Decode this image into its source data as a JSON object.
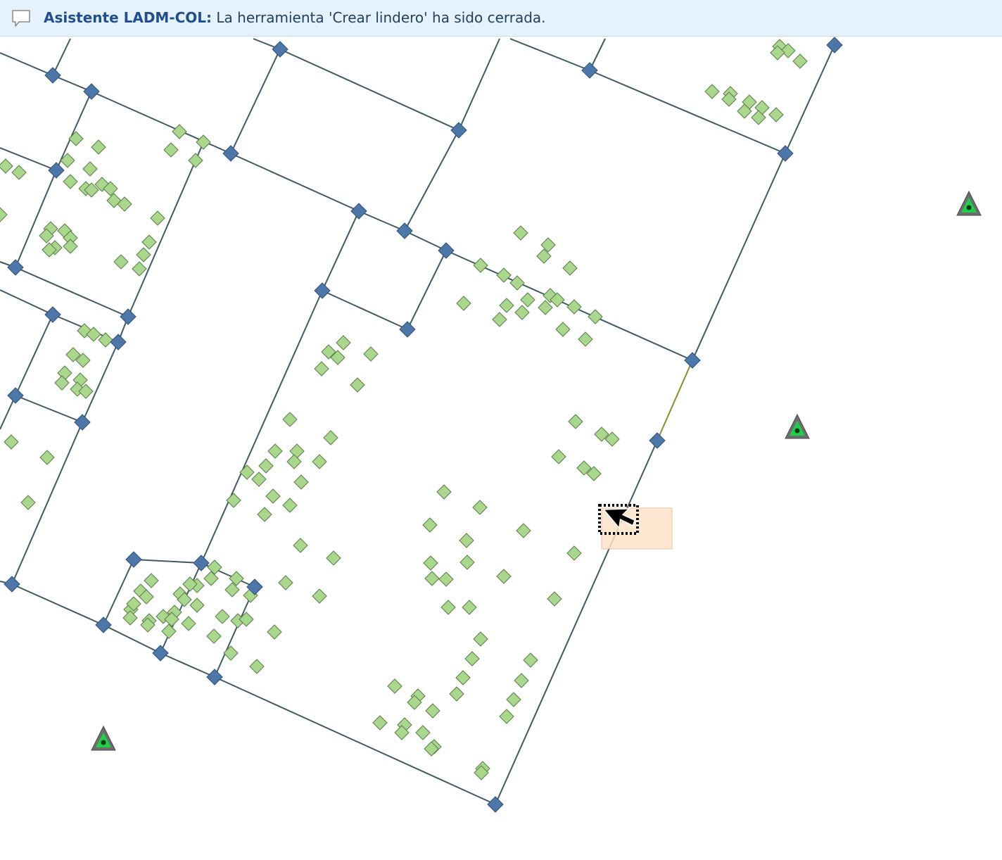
{
  "message_bar": {
    "title": "Asistente LADM-COL:",
    "text": "La herramienta 'Crear lindero' ha sido cerrada."
  },
  "map": {
    "colors": {
      "boundary_line": "#3f5a62",
      "selected_boundary": "#8a8a2a",
      "boundary_point": "#4d77a8",
      "survey_point_fill": "#a9d88c",
      "survey_point_stroke": "#5d7a4c",
      "control_point_outer": "#6d6d6d",
      "control_point_inner": "#1ecf4a",
      "selection_box": "#fde3c9"
    },
    "icons": {
      "boundary_point": "diamond-icon",
      "survey_point": "diamond-icon",
      "control_point": "triangle-icon",
      "cursor": "arrow-cursor-icon"
    }
  }
}
